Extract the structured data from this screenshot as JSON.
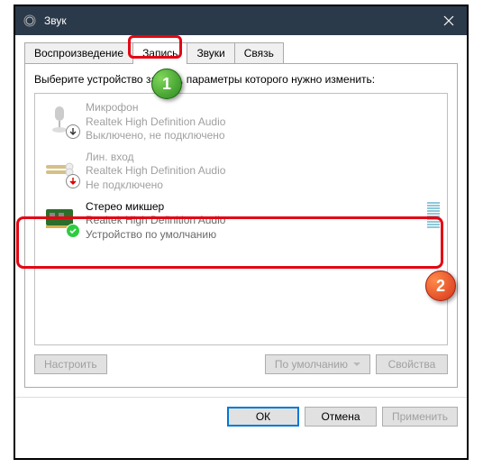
{
  "window": {
    "title": "Звук",
    "close": "×"
  },
  "tabs": {
    "playback": "Воспроизведение",
    "recording": "Запись",
    "sounds": "Звуки",
    "communications": "Связь"
  },
  "instruction": "Выберите устройство записи, параметры которого нужно изменить:",
  "devices": [
    {
      "name": "Микрофон",
      "driver": "Realtek High Definition Audio",
      "status": "Выключено, не подключено"
    },
    {
      "name": "Лин. вход",
      "driver": "Realtek High Definition Audio",
      "status": "Не подключено"
    },
    {
      "name": "Стерео микшер",
      "driver": "Realtek High Definition Audio",
      "status": "Устройство по умолчанию"
    }
  ],
  "buttons": {
    "configure": "Настроить",
    "set_default": "По умолчанию",
    "properties": "Свойства",
    "ok": "ОК",
    "cancel": "Отмена",
    "apply": "Применить"
  },
  "annotations": {
    "step1": "1",
    "step2": "2"
  }
}
